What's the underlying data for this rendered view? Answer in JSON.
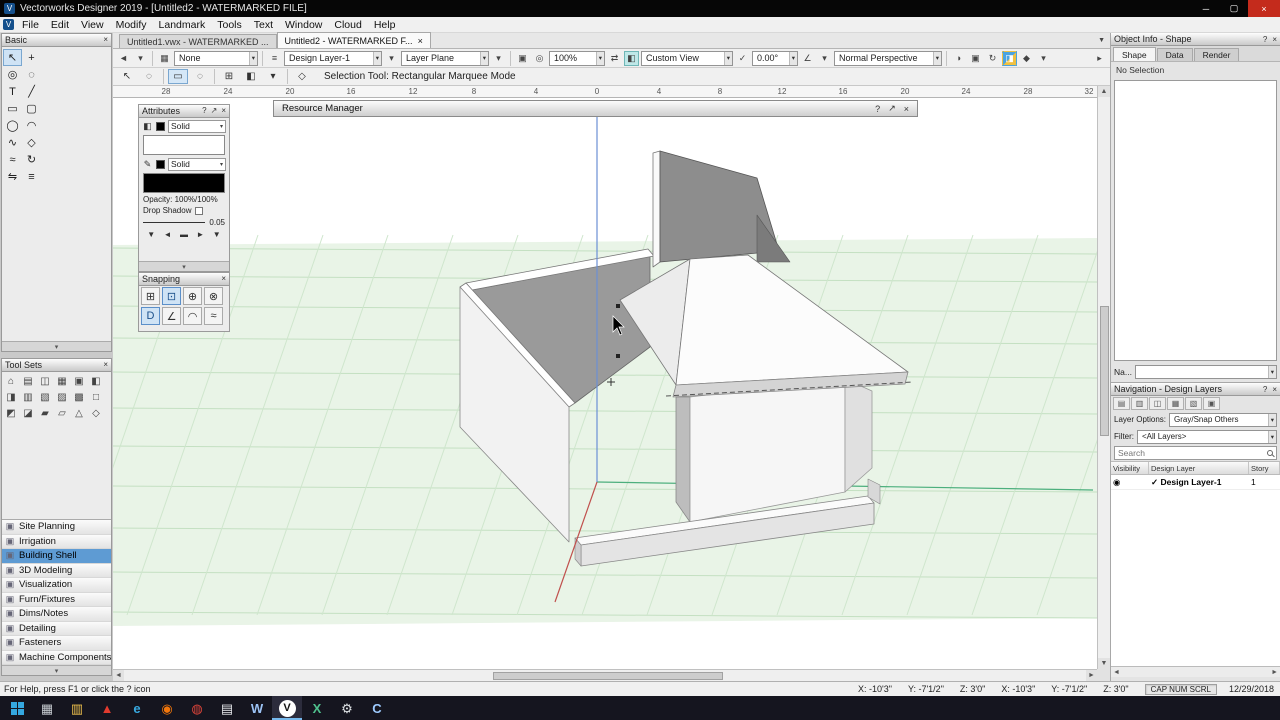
{
  "window": {
    "title": "Vectorworks Designer 2019 - [Untitled2 - WATERMARKED FILE]",
    "app_letter": "V",
    "minimize_glyph": "─",
    "maximize_glyph": "▢",
    "close_glyph": "×"
  },
  "menubar": {
    "items": [
      "File",
      "Edit",
      "View",
      "Modify",
      "Landmark",
      "Tools",
      "Text",
      "Window",
      "Cloud",
      "Help"
    ]
  },
  "doc_tabs": {
    "tabs": [
      {
        "label": "Untitled1.vwx - WATERMARKED ..."
      },
      {
        "label": "Untitled2 - WATERMARKED F..."
      }
    ],
    "close_glyph": "×",
    "overflow_glyph": "▼"
  },
  "view_bar": {
    "back_icon": "◄",
    "back_caret": "▾",
    "class_icon": "▦",
    "class_value": "None",
    "layers_icon": "≡",
    "layer_value": "Design Layer-1",
    "layer_caret": "▾",
    "plane_value": "Layer Plane",
    "plane_caret": "▾",
    "fit_icon": "▣",
    "zoom_icon": "◎",
    "zoom_value": "100%",
    "pan_icon": "⇄",
    "unified_icon": "◧",
    "view_value": "Custom View",
    "saved_view_icon": "✓",
    "angle_value": "0.00°",
    "walk_icon": "∠",
    "walk_caret": "▾",
    "projection_value": "Normal Perspective",
    "render_icons": [
      "◑",
      "▣",
      "↻",
      "◨",
      "◆",
      "▾"
    ],
    "overflow_icon": "▸"
  },
  "mode_bar": {
    "tool_icon": "↖",
    "tool2_icon": "◌",
    "modes": [
      "▭",
      "◌",
      "⊞",
      "◧"
    ],
    "caret": "▾",
    "extra_icon": "◇",
    "status": "Selection Tool: Rectangular Marquee Mode"
  },
  "basic_palette": {
    "title": "Basic",
    "close_glyph": "×",
    "collapse_glyph": "▾",
    "tools": [
      {
        "name": "selection",
        "glyph": "↖"
      },
      {
        "name": "pan",
        "glyph": "+"
      },
      {
        "name": "zoom",
        "glyph": "◎"
      },
      {
        "name": "snap-loupe",
        "glyph": "◌"
      },
      {
        "name": "text",
        "glyph": "T"
      },
      {
        "name": "line",
        "glyph": "╱"
      },
      {
        "name": "rectangle",
        "glyph": "▭"
      },
      {
        "name": "rounded-rectangle",
        "glyph": "▢"
      },
      {
        "name": "oval",
        "glyph": "◯"
      },
      {
        "name": "arc",
        "glyph": "◠"
      },
      {
        "name": "polyline",
        "glyph": "∿"
      },
      {
        "name": "polygon",
        "glyph": "◇"
      },
      {
        "name": "freehand",
        "glyph": "≈"
      },
      {
        "name": "rotate",
        "glyph": "↻"
      },
      {
        "name": "mirror",
        "glyph": "⇋"
      },
      {
        "name": "offset",
        "glyph": "≡"
      }
    ]
  },
  "tool_sets": {
    "title": "Tool Sets",
    "close_glyph": "×",
    "collapse_glyph": "▾",
    "tool_icons": [
      "⌂",
      "▤",
      "◫",
      "▦",
      "▣",
      "◧",
      "◨",
      "▥",
      "▧",
      "▨",
      "▩",
      "□",
      "◩",
      "◪",
      "▰",
      "▱",
      "△",
      "◇"
    ],
    "categories": [
      {
        "label": "Site Planning"
      },
      {
        "label": "Irrigation"
      },
      {
        "label": "Building Shell"
      },
      {
        "label": "3D Modeling"
      },
      {
        "label": "Visualization"
      },
      {
        "label": "Furn/Fixtures"
      },
      {
        "label": "Dims/Notes"
      },
      {
        "label": "Detailing"
      },
      {
        "label": "Fasteners"
      },
      {
        "label": "Machine Components"
      }
    ]
  },
  "attributes": {
    "title": "Attributes",
    "help_glyph": "?",
    "pin_glyph": "↗",
    "close_glyph": "×",
    "fill_icon": "◧",
    "fill_style": "Solid",
    "pen_icon": "✎",
    "pen_style": "Solid",
    "caret": "▾",
    "opacity_text": "Opacity: 100%/100%",
    "drop_shadow_label": "Drop Shadow",
    "line_weight_value": "0.05",
    "arrow_icons": [
      "▼",
      "◄",
      "▬",
      "►",
      "▼"
    ],
    "collapse_glyph": "▾"
  },
  "snapping": {
    "title": "Snapping",
    "close_glyph": "×",
    "row1": [
      "⊞",
      "⊡",
      "⊕",
      "⊗"
    ],
    "row2": [
      "D",
      "∠",
      "◠",
      "≈"
    ]
  },
  "resource_manager": {
    "title": "Resource Manager",
    "help_glyph": "?",
    "pin_glyph": "↗",
    "close_glyph": "×"
  },
  "object_info": {
    "title": "Object Info - Shape",
    "help_glyph": "?",
    "close_glyph": "×",
    "tabs": [
      {
        "label": "Shape"
      },
      {
        "label": "Data"
      },
      {
        "label": "Render"
      }
    ],
    "no_selection": "No Selection",
    "name_label": "Na...",
    "caret": "▾"
  },
  "navigation": {
    "title": "Navigation - Design Layers",
    "help_glyph": "?",
    "close_glyph": "×",
    "toolbar_icons": [
      "▤",
      "▥",
      "◫",
      "▦",
      "▧",
      "▣"
    ],
    "layer_options_label": "Layer Options:",
    "layer_options_value": "Gray/Snap Others",
    "filter_label": "Filter:",
    "filter_value": "<All Layers>",
    "search_placeholder": "Search",
    "columns": {
      "visibility": "Visibility",
      "layer": "Design Layer",
      "story": "Story"
    },
    "row": {
      "visibility_icon": "◉",
      "check": "✓",
      "name": "Design Layer-1",
      "number": "1"
    },
    "scroll_left": "◄",
    "scroll_right": "►"
  },
  "ruler": {
    "ticks": [
      "28",
      "24",
      "20",
      "16",
      "12",
      "8",
      "4",
      "0",
      "4",
      "8",
      "12",
      "16",
      "20",
      "24",
      "28",
      "32"
    ]
  },
  "status_bar": {
    "help": "For Help, press F1 or click the ? icon",
    "coords": [
      "X: -10'3\"",
      "Y: -7'1/2\"",
      "Z: 3'0\"",
      "X: -10'3\"",
      "Y: -7'1/2\"",
      "Z: 3'0\""
    ],
    "locks": "CAP NUM SCRL",
    "date": "12/29/2018"
  },
  "taskbar": {
    "icons": [
      {
        "name": "task-view",
        "glyph": "▦",
        "color": "#c7ccd1"
      },
      {
        "name": "file-explorer",
        "glyph": "▥",
        "color": "#f3c54e"
      },
      {
        "name": "acrobat",
        "glyph": "▲",
        "color": "#e23b2e"
      },
      {
        "name": "edge",
        "glyph": "e",
        "color": "#38a9e0"
      },
      {
        "name": "firefox",
        "glyph": "◉",
        "color": "#f3770b"
      },
      {
        "name": "chrome",
        "glyph": "◍",
        "color": "#e0453a"
      },
      {
        "name": "notepad",
        "glyph": "▤",
        "color": "#e8eaed"
      },
      {
        "name": "word",
        "glyph": "W",
        "color": "#9cc3f5"
      },
      {
        "name": "vectorworks",
        "glyph": "V",
        "color": "#111111"
      },
      {
        "name": "excel",
        "glyph": "X",
        "color": "#4fc08d"
      },
      {
        "name": "settings",
        "glyph": "⚙",
        "color": "#dfe3e6"
      },
      {
        "name": "console",
        "glyph": "C",
        "color": "#9ecbff"
      }
    ]
  }
}
